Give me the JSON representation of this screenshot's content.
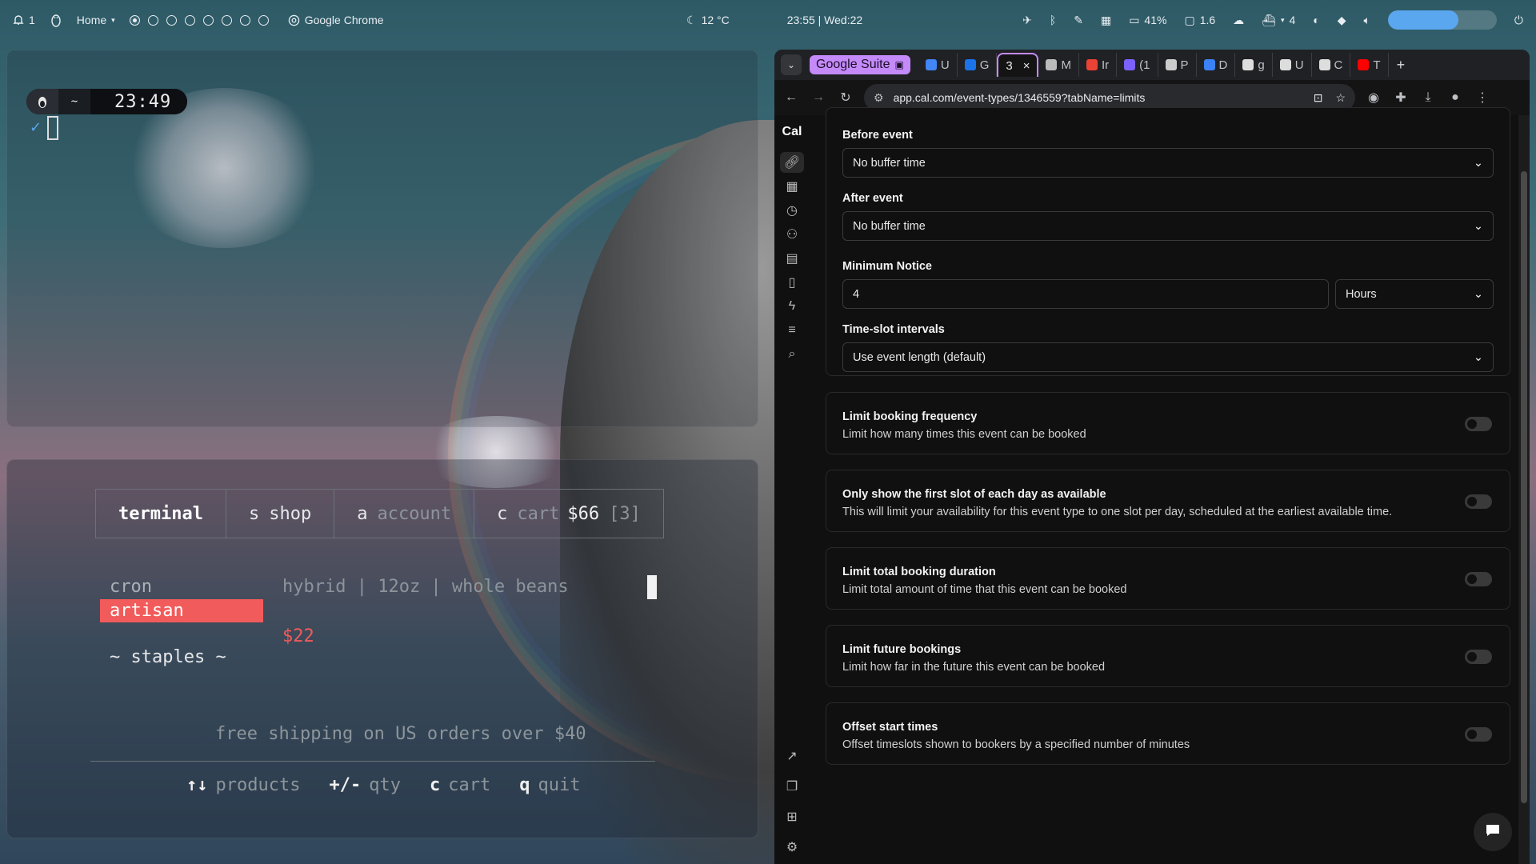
{
  "topbar": {
    "notifications": "1",
    "menu_label": "Home",
    "active_app": "Google Chrome",
    "weather": "12 °C",
    "datetime": "23:55 | Wed:22",
    "battery": "41%",
    "monitor": "1.6",
    "docker_count": "4",
    "volume_level": 0.65,
    "workspaces": 8,
    "active_workspace": 1
  },
  "clock_terminal": {
    "dir": "~",
    "time": "23:49",
    "check": "✓"
  },
  "shop_terminal": {
    "tabs": [
      {
        "key": "",
        "label": "terminal"
      },
      {
        "key": "s",
        "label": "shop"
      },
      {
        "key": "a",
        "label": "account"
      },
      {
        "key": "c",
        "label": "cart",
        "amount": "$66",
        "count": "[3]"
      }
    ],
    "menu": [
      "cron",
      "artisan",
      "~ staples ~"
    ],
    "selected": "artisan",
    "product_desc": "hybrid | 12oz | whole beans",
    "product_price": "$22",
    "shipping_note": "free shipping on US orders over $40",
    "keys": [
      {
        "key": "↑↓",
        "label": "products"
      },
      {
        "key": "+/-",
        "label": "qty"
      },
      {
        "key": "c",
        "label": "cart"
      },
      {
        "key": "q",
        "label": "quit"
      }
    ]
  },
  "browser": {
    "group_label": "Google Suite",
    "tabs": [
      {
        "label": "U",
        "color": "#4285f4"
      },
      {
        "label": "G",
        "color": "#1a73e8"
      },
      {
        "label": "3",
        "color": "#c58af9",
        "active": true
      },
      {
        "label": "M",
        "color": "#bbbbbb"
      },
      {
        "label": "Ir",
        "color": "#ea4335"
      },
      {
        "label": "(1",
        "color": "#7b61ff"
      },
      {
        "label": "P",
        "color": "#cccccc"
      },
      {
        "label": "D",
        "color": "#3b82f6"
      },
      {
        "label": "g",
        "color": "#dddddd"
      },
      {
        "label": "U",
        "color": "#dddddd"
      },
      {
        "label": "C",
        "color": "#dddddd"
      },
      {
        "label": "T",
        "color": "#ff0000"
      }
    ],
    "url": "app.cal.com/event-types/1346559?tabName=limits"
  },
  "cal": {
    "logo": "Cal",
    "before_event_label": "Before event",
    "before_event_value": "No buffer time",
    "after_event_label": "After event",
    "after_event_value": "No buffer time",
    "min_notice_label": "Minimum Notice",
    "min_notice_value": "4",
    "min_notice_unit": "Hours",
    "slot_interval_label": "Time-slot intervals",
    "slot_interval_value": "Use event length (default)",
    "limits": [
      {
        "title": "Limit booking frequency",
        "desc": "Limit how many times this event can be booked",
        "enabled": false
      },
      {
        "title": "Only show the first slot of each day as available",
        "desc": "This will limit your availability for this event type to one slot per day, scheduled at the earliest available time.",
        "enabled": false
      },
      {
        "title": "Limit total booking duration",
        "desc": "Limit total amount of time that this event can be booked",
        "enabled": false
      },
      {
        "title": "Limit future bookings",
        "desc": "Limit how far in the future this event can be booked",
        "enabled": false
      },
      {
        "title": "Offset start times",
        "desc": "Offset timeslots shown to bookers by a specified number of minutes",
        "enabled": false
      }
    ]
  }
}
